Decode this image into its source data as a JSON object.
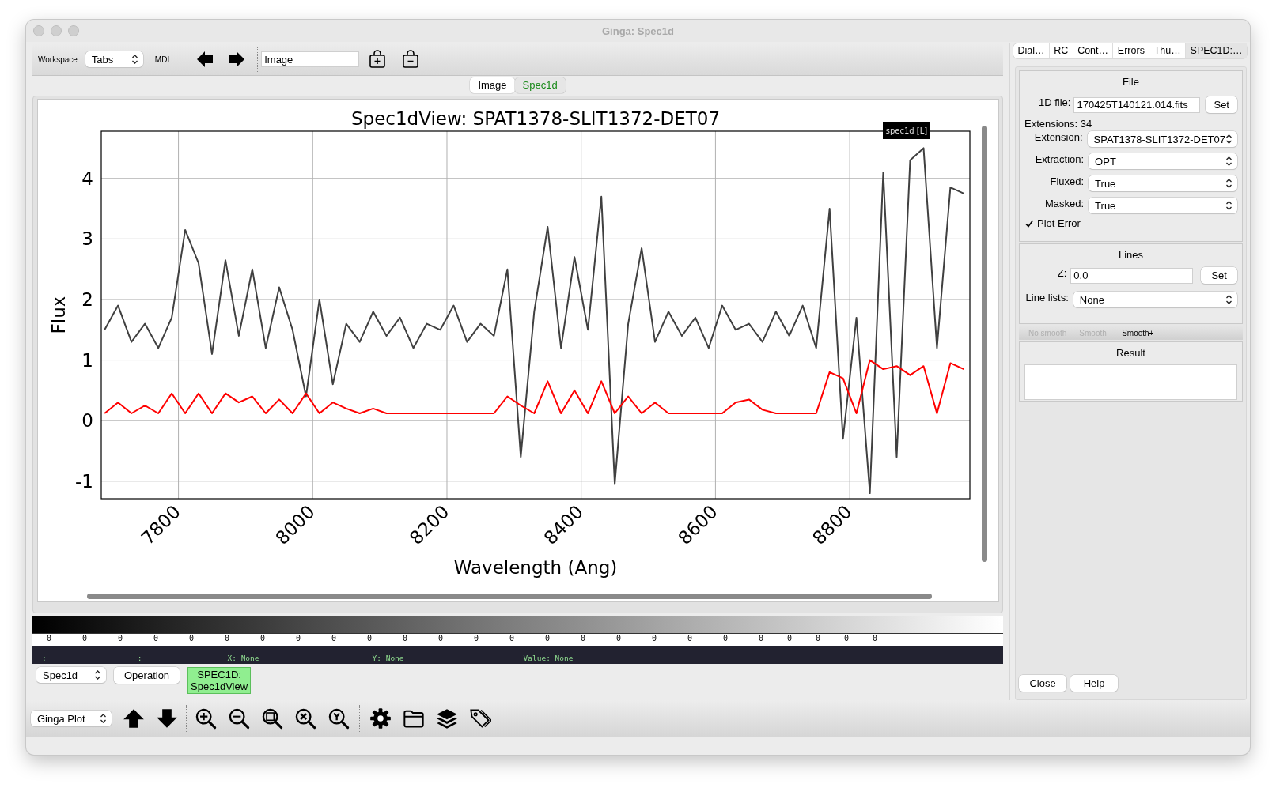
{
  "window": {
    "title": "Ginga: Spec1d"
  },
  "toolbar": {
    "workspace_label": "Workspace",
    "workspace_select": "Tabs",
    "mdi_label": "MDI",
    "channel_field": "Image"
  },
  "channel_tabs": [
    {
      "label": "Image",
      "selected": false
    },
    {
      "label": "Spec1d",
      "selected": true
    }
  ],
  "plot": {
    "canvas_label": "spec1d [L]",
    "chart_data": {
      "type": "line",
      "grid": true,
      "title": "Spec1dView: SPAT1378-SLIT1372-DET07",
      "xlabel": "Wavelength (Ang)",
      "ylabel": "Flux",
      "xlim": [
        7685,
        8979
      ],
      "ylim": [
        -1.29,
        4.78
      ],
      "xticks": [
        7800,
        8000,
        8200,
        8400,
        8600,
        8800
      ],
      "yticks": [
        -1,
        0,
        1,
        2,
        3,
        4
      ],
      "x": [
        7690,
        7710,
        7730,
        7750,
        7770,
        7790,
        7810,
        7830,
        7850,
        7870,
        7890,
        7910,
        7930,
        7950,
        7970,
        7990,
        8010,
        8030,
        8050,
        8070,
        8090,
        8110,
        8130,
        8150,
        8170,
        8190,
        8210,
        8230,
        8250,
        8270,
        8290,
        8310,
        8330,
        8350,
        8370,
        8390,
        8410,
        8430,
        8450,
        8470,
        8490,
        8510,
        8530,
        8550,
        8570,
        8590,
        8610,
        8630,
        8650,
        8670,
        8690,
        8710,
        8730,
        8750,
        8770,
        8790,
        8810,
        8830,
        8850,
        8870,
        8890,
        8910,
        8930,
        8950,
        8970
      ],
      "series": [
        {
          "color": "#404040",
          "values": [
            1.5,
            1.9,
            1.3,
            1.6,
            1.2,
            1.7,
            3.15,
            2.6,
            1.1,
            2.65,
            1.4,
            2.5,
            1.2,
            2.2,
            1.5,
            0.4,
            2.0,
            0.6,
            1.6,
            1.3,
            1.8,
            1.4,
            1.7,
            1.2,
            1.6,
            1.5,
            1.9,
            1.3,
            1.6,
            1.4,
            2.5,
            -0.6,
            1.8,
            3.2,
            1.2,
            2.7,
            1.5,
            3.7,
            -1.05,
            1.6,
            2.85,
            1.3,
            1.8,
            1.4,
            1.7,
            1.2,
            1.9,
            1.5,
            1.6,
            1.3,
            1.8,
            1.4,
            1.9,
            1.2,
            3.5,
            -0.3,
            1.7,
            -1.2,
            4.1,
            -0.6,
            4.3,
            4.5,
            1.2,
            3.85,
            3.75
          ]
        },
        {
          "color": "#ff0000",
          "values": [
            0.12,
            0.3,
            0.12,
            0.25,
            0.12,
            0.45,
            0.12,
            0.45,
            0.12,
            0.45,
            0.3,
            0.4,
            0.12,
            0.35,
            0.12,
            0.45,
            0.12,
            0.3,
            0.2,
            0.12,
            0.2,
            0.12,
            0.12,
            0.12,
            0.12,
            0.12,
            0.12,
            0.12,
            0.12,
            0.12,
            0.4,
            0.25,
            0.12,
            0.65,
            0.12,
            0.5,
            0.12,
            0.65,
            0.12,
            0.4,
            0.12,
            0.3,
            0.12,
            0.12,
            0.12,
            0.12,
            0.12,
            0.3,
            0.35,
            0.18,
            0.12,
            0.12,
            0.12,
            0.12,
            0.8,
            0.7,
            0.12,
            1.0,
            0.85,
            0.9,
            0.75,
            0.9,
            0.12,
            0.95,
            0.85
          ]
        }
      ]
    }
  },
  "colorbar": {
    "ticks": [
      "0",
      "0",
      "0",
      "0",
      "0",
      "0",
      "0",
      "0",
      "0",
      "0",
      "0",
      "0",
      "0",
      "0",
      "0",
      "0",
      "0",
      "0",
      "0",
      "0",
      "0",
      "0",
      "0",
      "0",
      "0"
    ]
  },
  "status_bar": {
    "fields": [
      ":",
      ":",
      "X: None",
      "Y: None",
      "Value: None"
    ]
  },
  "operations": {
    "channel_select": "Spec1d",
    "operation_button": "Operation",
    "plugins": [
      {
        "label": "SPEC1D: Spec1dView",
        "selected": true
      }
    ]
  },
  "plot_toolbar": {
    "select": "Ginga Plot"
  },
  "side_tabs": [
    {
      "label": "Dial…",
      "selected": false
    },
    {
      "label": "RC",
      "selected": false
    },
    {
      "label": "Cont…",
      "selected": false
    },
    {
      "label": "Errors",
      "selected": false
    },
    {
      "label": "Thu…",
      "selected": false
    },
    {
      "label": "SPEC1D:…",
      "selected": true
    }
  ],
  "file_group": {
    "title": "File",
    "file_label": "1D file:",
    "file_value": "170425T140121.014.fits",
    "set_button": "Set",
    "extensions": "Extensions: 34",
    "fields": [
      {
        "label": "Extension:",
        "value": "SPAT1378-SLIT1372-DET07"
      },
      {
        "label": "Extraction:",
        "value": "OPT"
      },
      {
        "label": "Fluxed:",
        "value": "True"
      },
      {
        "label": "Masked:",
        "value": "True"
      }
    ],
    "plot_error": {
      "label": "Plot Error",
      "checked": true
    }
  },
  "lines_group": {
    "title": "Lines",
    "z_label": "Z:",
    "z_value": "0.0",
    "set_button": "Set",
    "list_label": "Line lists:",
    "list_value": "None"
  },
  "smooth_buttons": [
    {
      "label": "No smooth",
      "disabled": true
    },
    {
      "label": "Smooth-",
      "disabled": true
    },
    {
      "label": "Smooth+",
      "disabled": false
    }
  ],
  "result_group": {
    "title": "Result"
  },
  "dialog_buttons": [
    "Close",
    "Help"
  ]
}
